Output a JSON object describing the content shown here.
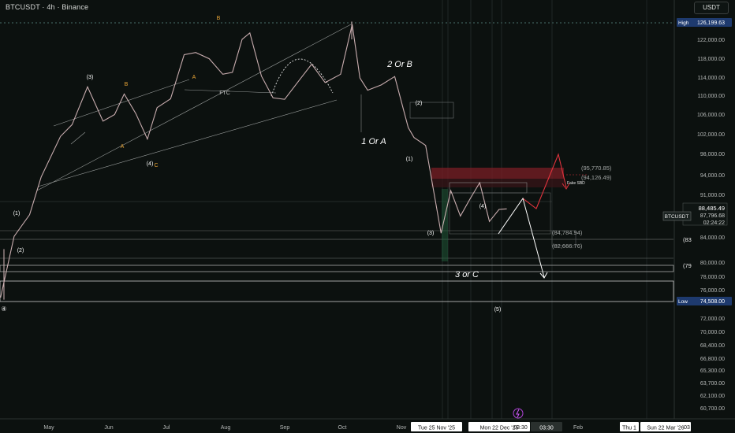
{
  "header": {
    "symbol_title": "BTCUSDT · 4h · Binance",
    "currency": "USDT"
  },
  "colors": {
    "background": "#0c110f",
    "price_line": "#e8e2e2",
    "candle_color": "#d4b6b8",
    "wave_label": "#ffffff",
    "sub_wave_label": "#e6a336",
    "projection": "#e0333d",
    "projection_down": "#ffffff",
    "resistance_zone": "#7a1e25",
    "badge_bg": "#1e3a6e"
  },
  "chart_data": {
    "type": "line",
    "symbol": "BTCUSDT",
    "timeframe": "4h",
    "exchange": "Binance",
    "y_axis": {
      "scale": "log",
      "ticks": [
        "122,000.00",
        "118,000.00",
        "114,000.00",
        "110,000.00",
        "106,000.00",
        "102,000.00",
        "98,000.00",
        "94,000.00",
        "91,000.00",
        "84,000.00",
        "80,000.00",
        "78,000.00",
        "76,000.00",
        "72,000.00",
        "70,000.00",
        "68,400.00",
        "66,800.00",
        "65,300.00",
        "63,700.00",
        "62,100.00",
        "60,700.00"
      ],
      "ylim": [
        59000,
        128500
      ]
    },
    "x_axis": {
      "ticks": [
        "May",
        "Jun",
        "Jul",
        "Aug",
        "Sep",
        "Oct",
        "Nov",
        "Feb"
      ],
      "crosshair_dates": [
        "Tue 25 Nov '25",
        "Mon 22 Dec '25",
        "Thu 1",
        "Sun 22 Mar '26"
      ],
      "crosshair_times": [
        "03:30",
        "03:30",
        "03"
      ]
    },
    "price_badges": {
      "high_label": "High",
      "high": "126,199.63",
      "low_label": "Low",
      "low": "74,508.00",
      "last_symbol": "BTCUSDT",
      "last": "88,485.49",
      "prev": "87,796.68",
      "countdown": "02:24:22",
      "level_83": "(83",
      "level_79": "(79"
    },
    "price_series": {
      "x_dates": [
        "2025-04-07",
        "2025-04-14",
        "2025-04-22",
        "2025-04-28",
        "2025-05-08",
        "2025-05-14",
        "2025-05-22",
        "2025-05-30",
        "2025-06-05",
        "2025-06-10",
        "2025-06-16",
        "2025-06-22",
        "2025-06-27",
        "2025-07-04",
        "2025-07-11",
        "2025-07-17",
        "2025-07-24",
        "2025-07-31",
        "2025-08-05",
        "2025-08-10",
        "2025-08-14",
        "2025-08-20",
        "2025-08-26",
        "2025-09-01",
        "2025-09-08",
        "2025-09-15",
        "2025-09-22",
        "2025-09-30",
        "2025-10-06",
        "2025-10-10",
        "2025-10-14",
        "2025-10-21",
        "2025-10-28",
        "2025-11-04",
        "2025-11-07",
        "2025-11-13",
        "2025-11-21",
        "2025-11-26",
        "2025-12-01",
        "2025-12-06",
        "2025-12-11",
        "2025-12-16",
        "2025-12-21",
        "2025-12-25"
      ],
      "close": [
        74800,
        84000,
        87500,
        94000,
        101500,
        103800,
        111500,
        104500,
        105800,
        110000,
        106000,
        101000,
        107200,
        109000,
        118500,
        119000,
        117600,
        114200,
        114600,
        122000,
        123500,
        113800,
        109200,
        108900,
        112600,
        116400,
        112400,
        114200,
        125500,
        113400,
        110800,
        111900,
        113700,
        103200,
        101300,
        99800,
        84500,
        91600,
        87300,
        90200,
        93000,
        86400,
        88400,
        88485
      ]
    },
    "wave_labels": [
      "(1)",
      "(2)",
      "(3)",
      "(4)",
      "A",
      "B",
      "C",
      "A",
      "B",
      "FTC",
      "1 Or A",
      "2 Or B",
      "(1)",
      "(2)",
      "(3)",
      "(4)",
      "(5)",
      "3 or C",
      "④"
    ],
    "annotations": {
      "fake_sbd": "Fake SBD",
      "level_95770": "(95,770.85)",
      "level_94126": "(94,126.49)",
      "level_84784": "(84,784.94)",
      "level_82666": "(82,666.76)"
    }
  }
}
